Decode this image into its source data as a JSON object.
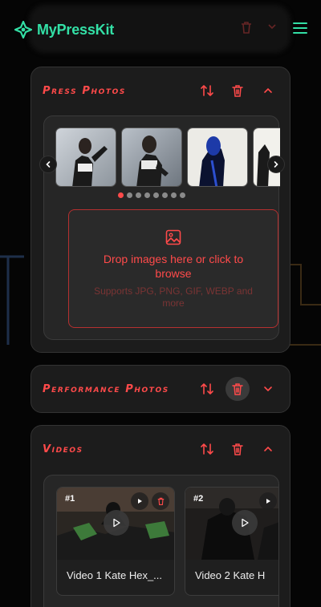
{
  "app": {
    "name": "MyPressKit"
  },
  "sections": {
    "press_photos": {
      "title": "Press Photos",
      "active_slide": 1,
      "slide_count": 8,
      "dropzone": {
        "title": "Drop images here or click to browse",
        "subtitle": "Supports JPG, PNG, GIF, WEBP and more"
      }
    },
    "performance_photos": {
      "title": "Performance Photos"
    },
    "videos": {
      "title": "Videos",
      "items": [
        {
          "badge": "#1",
          "title": "Video 1 Kate Hex_..."
        },
        {
          "badge": "#2",
          "title": "Video 2 Kate H"
        }
      ]
    }
  },
  "colors": {
    "accent": "#ff4a4a",
    "brand": "#33e0a6",
    "surface": "#1c1c1c"
  },
  "icons": [
    "logo-icon",
    "menu-icon",
    "sort-icon",
    "trash-icon",
    "chevron-up-icon",
    "chevron-down-icon",
    "chevron-left-icon",
    "chevron-right-icon",
    "image-icon",
    "play-icon"
  ]
}
